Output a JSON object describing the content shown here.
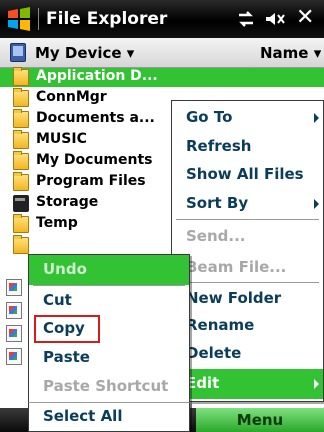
{
  "title_bar": {
    "title": "File Explorer",
    "connectivity_icon": "connectivity-icon",
    "volume_icon": "volume-icon",
    "close_glyph": "✕"
  },
  "location_bar": {
    "location": "My Device ▾",
    "sort": "Name ▾"
  },
  "files": [
    {
      "name": "Application D...",
      "icon": "folder-icon",
      "selected": true
    },
    {
      "name": "ConnMgr",
      "icon": "folder-icon"
    },
    {
      "name": "Documents a...",
      "icon": "folder-icon"
    },
    {
      "name": "MUSIC",
      "icon": "folder-icon"
    },
    {
      "name": "My Documents",
      "icon": "folder-icon"
    },
    {
      "name": "Program Files",
      "icon": "folder-icon"
    },
    {
      "name": "Storage",
      "icon": "storage-card-icon"
    },
    {
      "name": "Temp",
      "icon": "folder-icon"
    }
  ],
  "main_menu": {
    "items": [
      {
        "label": "Go To",
        "submenu": true
      },
      {
        "label": "Refresh"
      },
      {
        "label": "Show All Files"
      },
      {
        "label": "Sort By",
        "submenu": true
      },
      {
        "label": "Send...",
        "disabled": true
      },
      {
        "label": "Beam File...",
        "disabled": true
      },
      {
        "label": "New Folder"
      },
      {
        "label": "Rename"
      },
      {
        "label": "Delete"
      },
      {
        "label": "Edit",
        "submenu": true,
        "highlighted": true
      }
    ]
  },
  "edit_menu": {
    "items": [
      {
        "label": "Undo",
        "disabled": true
      },
      {
        "label": "Cut"
      },
      {
        "label": "Copy",
        "marked": true
      },
      {
        "label": "Paste"
      },
      {
        "label": "Paste Shortcut",
        "disabled": true
      },
      {
        "label": "Select All"
      }
    ]
  },
  "softkeys": {
    "right": "Menu"
  },
  "colors": {
    "selection_green": "#33c233",
    "menu_text": "#0a3d5a",
    "disabled_text": "#a8a8a8",
    "copy_marker": "#d41c1c"
  }
}
